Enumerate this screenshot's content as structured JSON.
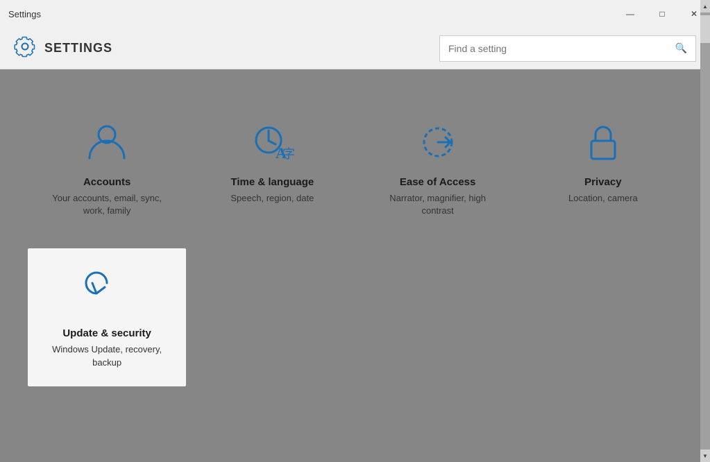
{
  "window": {
    "title": "Settings",
    "minimize_label": "—",
    "maximize_label": "□",
    "close_label": "✕"
  },
  "header": {
    "app_title": "SETTINGS",
    "search_placeholder": "Find a setting"
  },
  "settings": [
    {
      "id": "accounts",
      "name": "Accounts",
      "desc": "Your accounts, email, sync, work, family",
      "icon": "accounts"
    },
    {
      "id": "time-language",
      "name": "Time & language",
      "desc": "Speech, region, date",
      "icon": "time-language"
    },
    {
      "id": "ease-of-access",
      "name": "Ease of Access",
      "desc": "Narrator, magnifier, high contrast",
      "icon": "ease-of-access"
    },
    {
      "id": "privacy",
      "name": "Privacy",
      "desc": "Location, camera",
      "icon": "privacy"
    },
    {
      "id": "update-security",
      "name": "Update & security",
      "desc": "Windows Update, recovery, backup",
      "icon": "update-security",
      "selected": true
    }
  ],
  "colors": {
    "icon_blue": "#1a6fb5",
    "selected_bg": "#f5f5f5"
  }
}
